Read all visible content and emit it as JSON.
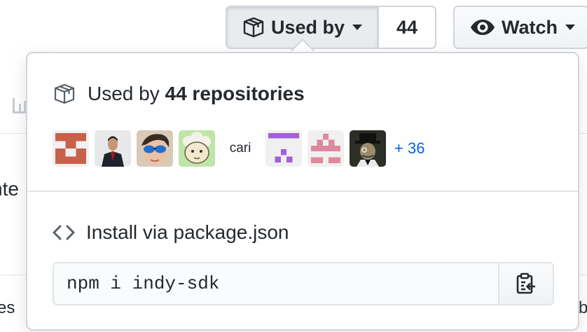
{
  "header": {
    "used_by_label": "Used by",
    "used_by_count": "44",
    "watch_label": "Watch"
  },
  "background": {
    "fragment_left_1": "nte",
    "fragment_left_2": "es",
    "fragment_right": "b"
  },
  "popover": {
    "used_by_prefix": "Used by",
    "used_by_strong": "44 repositories",
    "avatars": [
      {
        "name": "avatar-orange-pattern"
      },
      {
        "name": "avatar-person-suit"
      },
      {
        "name": "avatar-person-sunglasses"
      },
      {
        "name": "avatar-sheep-cartoon"
      },
      {
        "name": "avatar-text",
        "text": "cari"
      },
      {
        "name": "avatar-purple-pattern"
      },
      {
        "name": "avatar-pink-pattern"
      },
      {
        "name": "avatar-person-hat"
      }
    ],
    "more_label": "+ 36",
    "install_title": "Install via package.json",
    "install_command": "npm i indy-sdk"
  },
  "icons": {
    "package": "package-icon",
    "eye": "eye-icon",
    "code": "code-icon",
    "clipboard": "clipboard-icon"
  },
  "colors": {
    "link": "#0366d6",
    "border": "#d1d5da"
  }
}
